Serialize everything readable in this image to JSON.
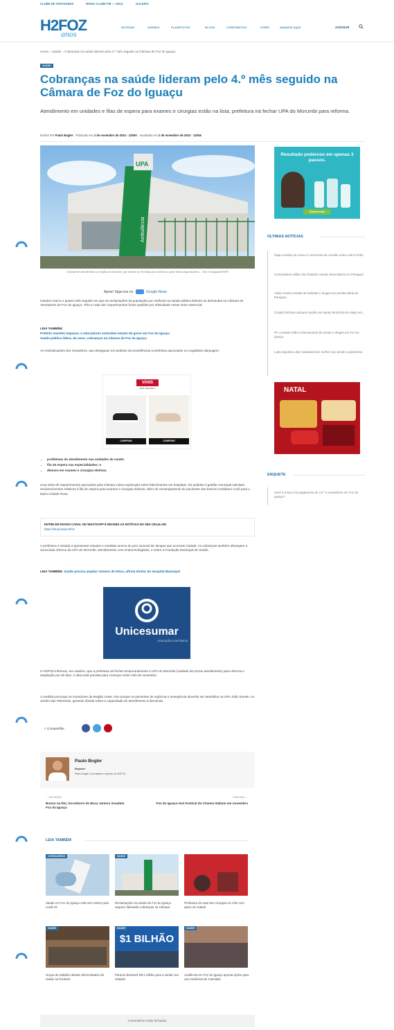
{
  "topbar": {
    "link1": "CLUBE DE VANTAGENS",
    "link2": "RÁDIO CLUBE FM — 100,9",
    "link3": "GALERIA"
  },
  "brand": {
    "logo_main": "H2FOZ",
    "logo_sub": "anos",
    "accent": "#1c7fb8"
  },
  "nav": {
    "items": [
      "NOTÍCIAS",
      "AGENDA",
      "PLANETA FOZ",
      "BLOGS",
      "CORPORATIVO",
      "CITIES",
      "ANUNCIE AQUI!"
    ],
    "login": "ACESSAR"
  },
  "breadcrumb": {
    "home": "Home",
    "sep": "»",
    "section": "Saúde",
    "current": "Cobranças na saúde lideram pelo 4.º mês seguido na Câmara de Foz do Iguaçu"
  },
  "article": {
    "category": "SAÚDE",
    "title": "Cobranças na saúde lideram pelo 4.º mês seguido na Câmara de Foz do Iguaçu",
    "subtitle": "Atendimento em unidades e filas de espera para exames e cirurgias estão na lista; prefeitura irá fechar UPA do Morumbi para reforma.",
    "author_label": "Escrito Por",
    "author": "Paulo Bogler",
    "published_label": "Publicado em",
    "published": "2 de novembro de 2022 - 12h00",
    "updated_label": "Atualizado em",
    "updated": "2 de novembro de 2022 - 12h46",
    "image_caption": "Unidade de atendimento na região do Morumbi; que deverá ser fechada para reforma a partir desta segunda-feira. – foto: Divulgação/PMFI",
    "support": "Apoie! Siga-nos no",
    "google_news": "Google News",
    "p1": "Outubro marca o quarto mês seguido em que as reclamações da população por melhoria na saúde pública lideram as demandas na Câmara de Vereadores de Foz do Iguaçu. Três a cada dez requerimentos foram pedidos por efetividade nesse setor essencial.",
    "read_also_label": "LEIA TAMBÉM:",
    "read_also_1": "Prefeito mantém impasse, e educadores estendem estado de greve em Foz do Iguaçu",
    "read_also_2": "Saúde pública lidera, de novo, cobranças na Câmara de Foz do Iguaçu",
    "p2": "As reivindicações dos moradores, que desaguam em pedidos de providências à prefeitura aprovados no Legislativo abrangem:",
    "bullets": [
      "problemas de atendimento nas unidades de saúde;",
      "fila de espera nas especialidades; e",
      "demora em exames e cirurgias eletivas."
    ],
    "p3": "Uma série de requerimentos aprovados pela Câmara cobra explicação sobre falecimentos em hospitais. Os pedidos à gestão municipal solicitam esclarecimentos relativos à fila de espera para exames e cirurgias eletivas, além do remanejamento de pacientes dos bairros Curitibano e Ipê para o bairro Cidade Nova.",
    "whatsapp_cta": "ENTRE EM NOSSO CANAL NO WHATSAPP E RECEBA AS NOTÍCIAS NO SEU CELULAR!",
    "whatsapp_link": "https://bit.ly/canal-h2foz",
    "p4": "A prefeitura é instada a apresentar estudos e medidas acerca do pico sazonal de dengue que acomete Cidade. As cobranças também abrangem a anunciada reforma da UPA do Morumbi, atendimentos com endocrinologistas, e sobre a Fundação Municipal de Saúde.",
    "read_also_3_label": "LEIA TAMBÉM:",
    "read_also_3": "Saúde precisa ampliar número de leitos, afirma diretor do Hospital Municipal",
    "p5_link": "H2FOZ",
    "p5": "O H2FOZ informou, em outubro, que a prefeitura irá fechar temporariamente a UPA do Morumbi (unidade de pronto atendimento) para reforma e ampliação por 60 dias. A obra está prevista para começar neste mês de novembro.",
    "p6": "A medida preocupa os moradores da Região Leste, isso porque os pacientes de urgência e emergência deverão ser atendidos na UPA João Samek, no Jardim das Palmeiras, gerando dúvida sobre a capacidade de atendimento à demanda.",
    "share_label": "Compartilhe"
  },
  "ads": {
    "vans_brand": "VANS",
    "vans_tag": "\"OFF THE WALL\"",
    "vans_btn1": "COMPRAR",
    "vans_btn2": "COMPRAR",
    "unicesumar_brand": "Unicesumar",
    "unicesumar_sub": "EDUCAÇÃO A DISTÂNCIA",
    "side_ad_title": "Resultado poderoso em apenas 3 passos.",
    "side_ad_btn": "Experimente",
    "natal": "NATAL"
  },
  "author_box": {
    "name": "Paulo Bogler",
    "role": "Repórter",
    "bio": "Paulo Bogler é jornalista e repórter do H2FOZ."
  },
  "post_nav": {
    "prev_label": "← ANTERIOR",
    "prev_title": "Bunno na Rio, torcedores do Boca Juniors invadem Foz do Iguaçu",
    "next_label": "PRÓXIMO →",
    "next_title": "Foz do Iguaçu terá Festival do Cinema Italiano em novembro"
  },
  "related": {
    "title": "LEIA TAMBÉM",
    "items": [
      {
        "tag": "CORONAVÍRUS",
        "caption": "Saúde em Foz do Iguaçu está sem testes para covid-19"
      },
      {
        "tag": "SAÚDE",
        "caption": "Reclamações na saúde de Foz do Iguaçu seguem liderando cobranças na Câmara"
      },
      {
        "tag": "",
        "caption": "Prefeitura do Ivaxi tem cirurgias no mês com apoio do estado"
      },
      {
        "tag": "SAÚDE",
        "caption": "Grupo de trabalho debate deformidades da saúde na fronteira"
      },
      {
        "tag": "SAÚDE",
        "caption": "Paraná destinará R$ 1 bilhão para a saúde nos estados"
      },
      {
        "tag": "SAÚDE",
        "caption": "Audiência em Foz do Iguaçu aponta ações para uso medicinal de Cannabis"
      }
    ],
    "banner_text": "$1 BILHÃO"
  },
  "comments_closed": "Comentários estão fechados.",
  "sidebar": {
    "latest_title": "ÚLTIMAS NOTÍCIAS",
    "latest": [
      "Itaipu revisão do Anexo C será tema de reunião entre Lula e Peña",
      "Comandante militar dos Estados Unidos desembarca no Paraguai",
      "Vídeo revela entrada de bebidas e drogas em penitenciária do Paraguai",
      "Ciudad del Este adotará modelo de Santa Terezinha de Itaipu em...",
      "PF combate tráfico internacional de armas e drogas em Foz do Iguaçu",
      "Lado argentino das Cataratas tem melhor ano desde a pandemia"
    ],
    "poll_title": "ENQUETE",
    "poll_question": "Você é a favor do pagamento de 13.º a vereadores em Foz do Iguaçu?"
  }
}
